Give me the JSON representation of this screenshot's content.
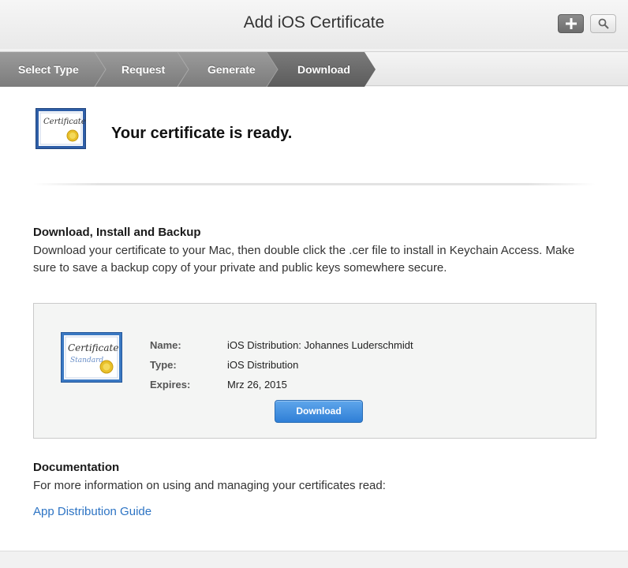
{
  "header": {
    "title": "Add iOS Certificate",
    "add_icon": "plus-icon",
    "search_icon": "search-icon"
  },
  "steps": {
    "items": [
      {
        "label": "Select Type"
      },
      {
        "label": "Request"
      },
      {
        "label": "Generate"
      },
      {
        "label": "Download",
        "current": true
      }
    ]
  },
  "main": {
    "heading": "Your certificate is ready.",
    "certificate_icon": "certificate-icon",
    "certificate_icon_text": "Certificate",
    "download_section": {
      "heading": "Download, Install and Backup",
      "text": "Download your certificate to your Mac, then double click the .cer file to install in Keychain Access. Make sure to save a backup copy of your private and public keys somewhere secure."
    },
    "panel": {
      "certificate_icon_text": "Certificate",
      "certificate_icon_subtext": "Standard",
      "name_label": "Name:",
      "name_value": "iOS Distribution: Johannes Luderschmidt",
      "type_label": "Type:",
      "type_value": "iOS Distribution",
      "expires_label": "Expires:",
      "expires_value": "Mrz 26, 2015",
      "download_label": "Download"
    },
    "documentation": {
      "heading": "Documentation",
      "text": "For more information on using and managing your certificates read:",
      "link": "App Distribution Guide"
    }
  },
  "colors": {
    "steps_completed": "#8b8b8b",
    "steps_current": "#6a6a6a",
    "accent_blue": "#2f7fd6",
    "link": "#2d74c4"
  }
}
